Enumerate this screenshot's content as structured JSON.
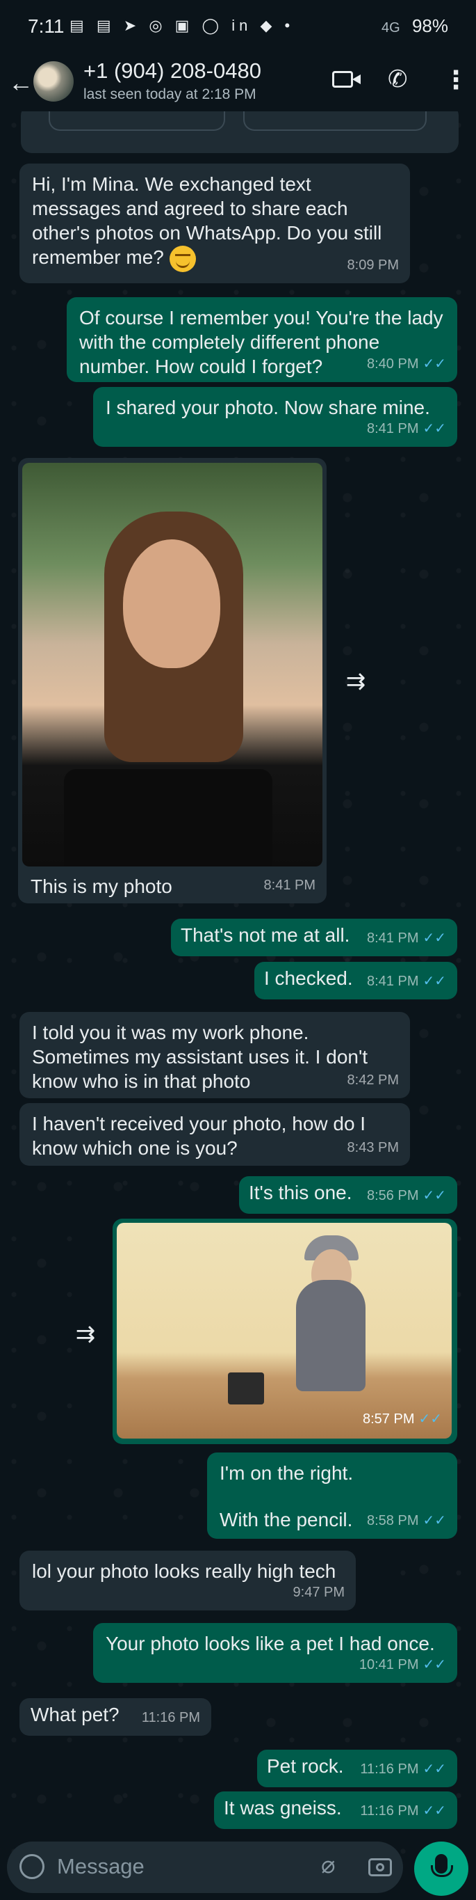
{
  "status_bar": {
    "time": "7:11",
    "notif_icons": "▤ ▤ ➤ ◎ ▣ ◯ in ◆ •",
    "signal": "4G",
    "battery": "98%"
  },
  "header": {
    "back_icon": "arrow-left",
    "name": "+1 (904) 208-0480",
    "status": "last seen today at 2:18 PM"
  },
  "messages": [
    {
      "dir": "in",
      "text": "Hi, I'm Mina. We exchanged text messages and agreed to share each other's photos on WhatsApp. Do you still remember me?",
      "emoji": "smiling-face",
      "time": "8:09 PM"
    },
    {
      "dir": "out",
      "text": "Of course I remember you!  You're the lady with the completely different phone number.  How could I forget?",
      "time": "8:40 PM"
    },
    {
      "dir": "out",
      "text": "I shared your photo.  Now share mine.",
      "time": "8:41 PM"
    },
    {
      "dir": "in",
      "type": "photo",
      "caption": "This is my photo",
      "time": "8:41 PM"
    },
    {
      "dir": "out",
      "text": "That's not me at all.",
      "time": "8:41 PM"
    },
    {
      "dir": "out",
      "text": "I checked.",
      "time": "8:41 PM"
    },
    {
      "dir": "in",
      "text": "I told you it was my work phone. Sometimes my assistant uses it. I don't know who is in that photo",
      "time": "8:42 PM"
    },
    {
      "dir": "in",
      "text": "I haven't received your photo, how do I know which one is you?",
      "time": "8:43 PM"
    },
    {
      "dir": "out",
      "text": "It's this one.",
      "time": "8:56 PM"
    },
    {
      "dir": "out",
      "type": "photo",
      "time": "8:57 PM"
    },
    {
      "dir": "out",
      "text_line1": "I'm on the right.",
      "text_line2": "With the pencil.",
      "time": "8:58 PM"
    },
    {
      "dir": "in",
      "text": "lol your photo looks really high tech",
      "time": "9:47 PM"
    },
    {
      "dir": "out",
      "text": "Your photo looks like a pet I had once.",
      "time": "10:41 PM"
    },
    {
      "dir": "in",
      "text": "What pet?",
      "time": "11:16 PM"
    },
    {
      "dir": "out",
      "text": "Pet rock.",
      "time": "11:16 PM"
    },
    {
      "dir": "out",
      "text": "It was gneiss.",
      "time": "11:16 PM"
    }
  ],
  "input": {
    "placeholder": "Message"
  },
  "icons": {
    "read": "✓✓",
    "forward": "forward-icon"
  },
  "colors": {
    "incoming": "#1f2c34",
    "outgoing": "#005c4b",
    "read_ticks": "#53bdeb",
    "mic_button": "#00a884"
  }
}
